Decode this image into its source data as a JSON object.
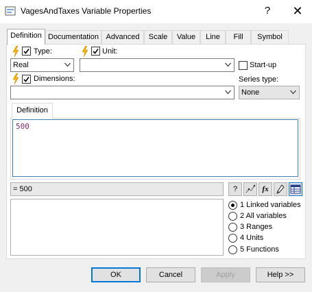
{
  "window": {
    "title": "VagesAndTaxes Variable Properties",
    "help_glyph": "?",
    "close_glyph": "✕"
  },
  "tabs": [
    "Definition",
    "Documentation",
    "Advanced",
    "Scale",
    "Value",
    "Line",
    "Fill",
    "Symbol"
  ],
  "active_tab": "Definition",
  "fields": {
    "type_label": "Type:",
    "type_value": "Real",
    "type_checked": true,
    "unit_label": "Unit:",
    "unit_value": "",
    "unit_checked": true,
    "startup_label": "Start-up",
    "startup_checked": false,
    "dimensions_label": "Dimensions:",
    "dimensions_value": "",
    "dimensions_checked": true,
    "series_type_label": "Series type:",
    "series_type_value": "None"
  },
  "definition": {
    "subtab_label": "Definition",
    "text": "500"
  },
  "result": {
    "text": "= 500"
  },
  "toolbar_icons": [
    "help-icon",
    "graph-icon",
    "function-icon",
    "pencil-icon",
    "table-icon"
  ],
  "toolbar_glyphs": {
    "help": "?",
    "function": "fx"
  },
  "radio_options": [
    {
      "label": "1 Linked variables",
      "selected": true
    },
    {
      "label": "2 All variables",
      "selected": false
    },
    {
      "label": "3 Ranges",
      "selected": false
    },
    {
      "label": "4 Units",
      "selected": false
    },
    {
      "label": "5 Functions",
      "selected": false
    }
  ],
  "buttons": {
    "ok": "OK",
    "cancel": "Cancel",
    "apply": "Apply",
    "help": "Help >>"
  },
  "colors": {
    "accent": "#0078d7",
    "bolt": "#f4b400",
    "definition_text": "#7b2d6e"
  }
}
